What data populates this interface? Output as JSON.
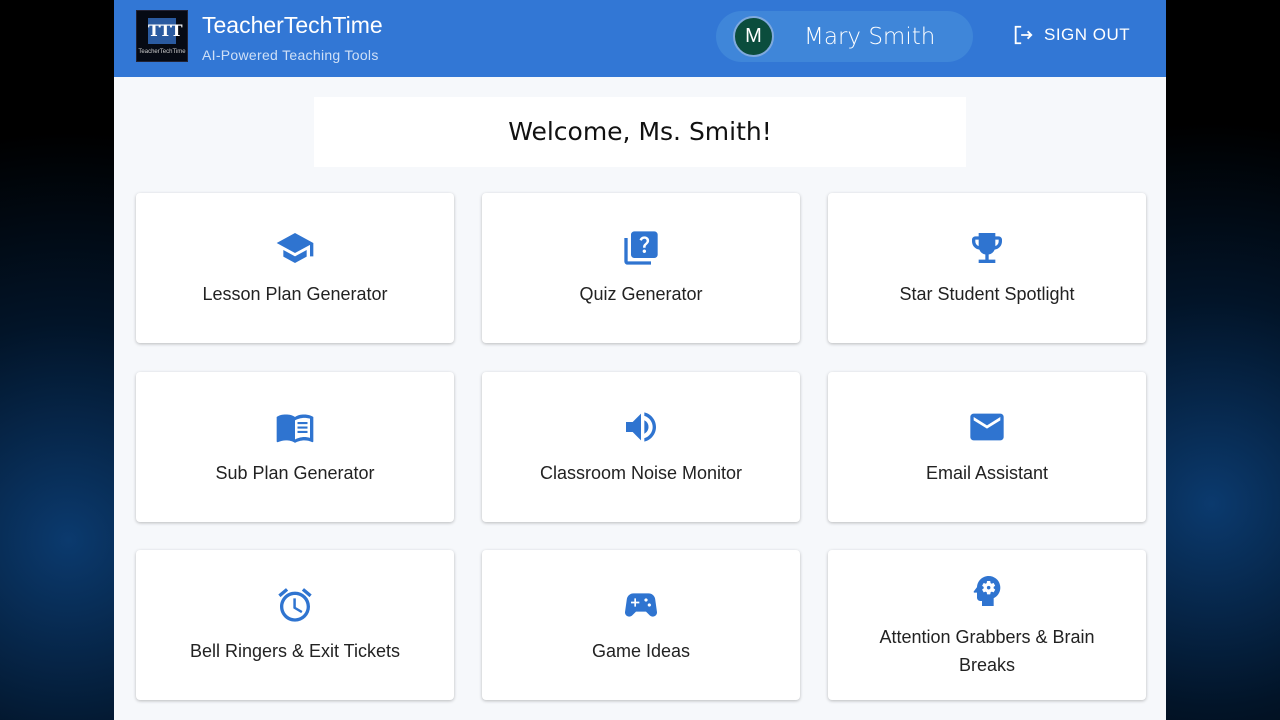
{
  "header": {
    "title": "TeacherTechTime",
    "subtitle": "AI-Powered Teaching Tools",
    "logo_text": "TeacherTechTime",
    "user_initial": "M",
    "user_name": "Mary Smith",
    "sign_out": "SIGN OUT"
  },
  "welcome": "Welcome, Ms. Smith!",
  "tools": [
    {
      "label": "Lesson Plan Generator",
      "icon": "graduation-cap-icon"
    },
    {
      "label": "Quiz Generator",
      "icon": "quiz-icon"
    },
    {
      "label": "Star Student Spotlight",
      "icon": "trophy-icon"
    },
    {
      "label": "Sub Plan Generator",
      "icon": "book-icon"
    },
    {
      "label": "Classroom Noise Monitor",
      "icon": "volume-icon"
    },
    {
      "label": "Email Assistant",
      "icon": "email-icon"
    },
    {
      "label": "Bell Ringers & Exit Tickets",
      "icon": "alarm-clock-icon"
    },
    {
      "label": "Game Ideas",
      "icon": "gamepad-icon"
    },
    {
      "label": "Attention Grabbers & Brain Breaks",
      "icon": "brain-gear-icon"
    }
  ]
}
